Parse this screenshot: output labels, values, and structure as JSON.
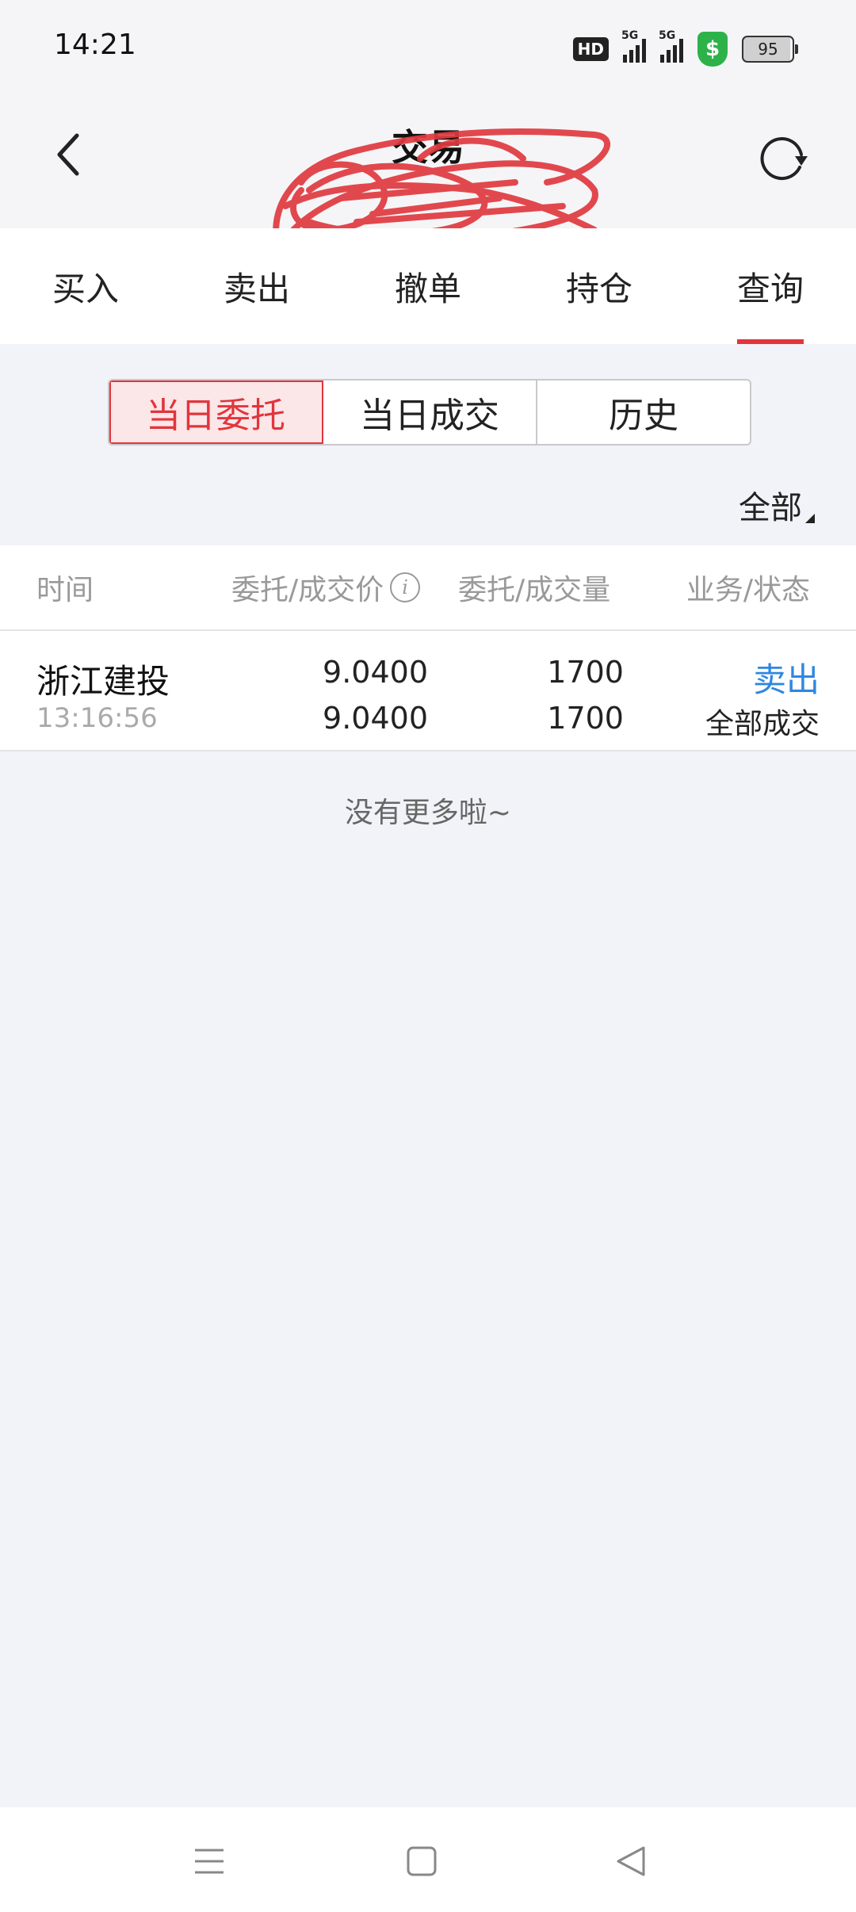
{
  "status_bar": {
    "time": "14:21",
    "hd_label": "HD",
    "signal1_label": "5G",
    "signal2_label": "5G",
    "shield_symbol": "$",
    "battery": "95",
    "shield_color": "#2db24a"
  },
  "nav": {
    "title": "交易",
    "back_icon": "chevron-left-icon",
    "refresh_icon": "refresh-icon"
  },
  "tabs": [
    {
      "label": "买入"
    },
    {
      "label": "卖出"
    },
    {
      "label": "撤单"
    },
    {
      "label": "持仓"
    },
    {
      "label": "查询"
    }
  ],
  "active_tab": "查询",
  "accent_color": "#e2353c",
  "segments": [
    {
      "label": "当日委托"
    },
    {
      "label": "当日成交"
    },
    {
      "label": "历史"
    }
  ],
  "filter_label": "全部",
  "table": {
    "headers": {
      "time": "时间",
      "price": "委托/成交价",
      "qty": "委托/成交量",
      "status": "业务/状态"
    },
    "rows": [
      {
        "name": "浙江建投",
        "time": "13:16:56",
        "order_price": "9.0400",
        "deal_price": "9.0400",
        "order_qty": "1700",
        "deal_qty": "1700",
        "action": "卖出",
        "status": "全部成交"
      }
    ]
  },
  "action_color": "#2f87e0",
  "no_more_text": "没有更多啦~"
}
